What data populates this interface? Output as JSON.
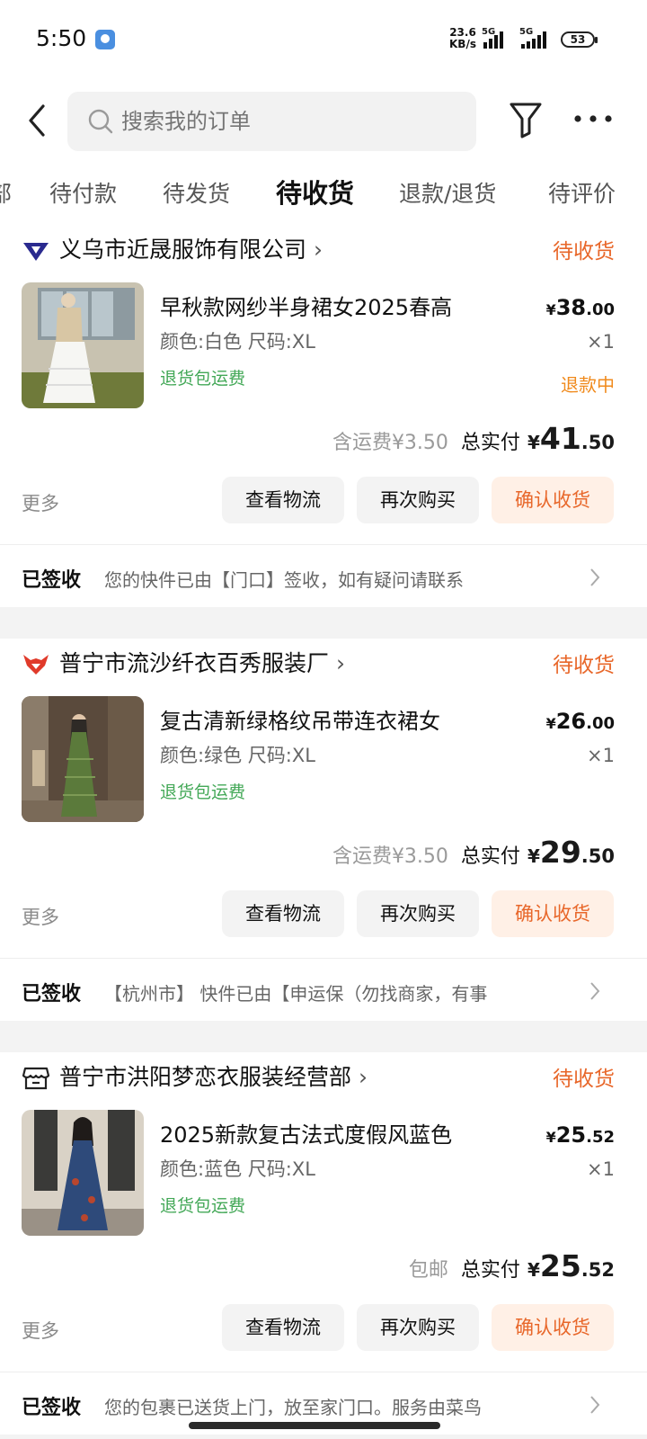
{
  "status_bar": {
    "time": "5:50",
    "speed_value": "23.6",
    "speed_unit": "KB/s",
    "net1": "5G",
    "net2": "5G",
    "battery": "53"
  },
  "search": {
    "placeholder": "搜索我的订单"
  },
  "tabs": [
    {
      "label": "部"
    },
    {
      "label": "待付款"
    },
    {
      "label": "待发货"
    },
    {
      "label": "待收货",
      "active": true
    },
    {
      "label": "退款/退货"
    },
    {
      "label": "待评价"
    }
  ],
  "orders": [
    {
      "shop": "义乌市近晟服饰有限公司",
      "status": "待收货",
      "title": "早秋款网纱半身裙女2025春高",
      "spec": "颜色:白色 尺码:XL",
      "return_badge": "退货包运费",
      "price_cur": "¥",
      "price_int": "38",
      "price_dec": ".00",
      "qty": "×1",
      "refund_status": "退款中",
      "shipping": "含运费¥3.50",
      "total_label": "总实付",
      "total_cur": "¥",
      "total_int": "41",
      "total_dec": ".50",
      "more": "更多",
      "btn_logistics": "查看物流",
      "btn_rebuy": "再次购买",
      "btn_confirm": "确认收货",
      "log_label": "已签收",
      "log_text": "您的快件已由【门口】签收，如有疑问请联系"
    },
    {
      "shop": "普宁市流沙纤衣百秀服装厂",
      "status": "待收货",
      "title": "复古清新绿格纹吊带连衣裙女",
      "spec": "颜色:绿色 尺码:XL",
      "return_badge": "退货包运费",
      "price_cur": "¥",
      "price_int": "26",
      "price_dec": ".00",
      "qty": "×1",
      "shipping": "含运费¥3.50",
      "total_label": "总实付",
      "total_cur": "¥",
      "total_int": "29",
      "total_dec": ".50",
      "more": "更多",
      "btn_logistics": "查看物流",
      "btn_rebuy": "再次购买",
      "btn_confirm": "确认收货",
      "log_label": "已签收",
      "log_text": "【杭州市】 快件已由【申运保（勿找商家，有事"
    },
    {
      "shop": "普宁市洪阳梦恋衣服装经营部",
      "status": "待收货",
      "title": "2025新款复古法式度假风蓝色",
      "spec": "颜色:蓝色 尺码:XL",
      "return_badge": "退货包运费",
      "price_cur": "¥",
      "price_int": "25",
      "price_dec": ".52",
      "qty": "×1",
      "shipping": "包邮",
      "total_label": "总实付",
      "total_cur": "¥",
      "total_int": "25",
      "total_dec": ".52",
      "more": "更多",
      "btn_logistics": "查看物流",
      "btn_rebuy": "再次购买",
      "btn_confirm": "确认收货",
      "log_label": "已签收",
      "log_text": "您的包裹已送货上门，放至家门口。服务由菜鸟"
    }
  ],
  "colors": {
    "accent": "#e8672a",
    "green": "#43a857",
    "refund": "#f08a1c"
  }
}
